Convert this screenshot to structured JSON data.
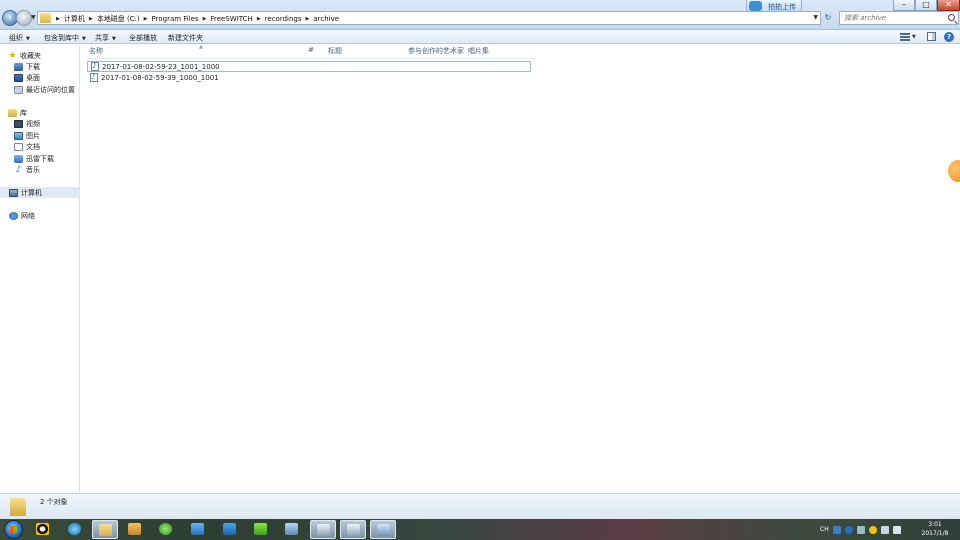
{
  "address": {
    "crumbs": [
      "计算机",
      "本地磁盘 (C:)",
      "Program Files",
      "FreeSWITCH",
      "recordings",
      "archive"
    ],
    "search_placeholder": "搜索 archive"
  },
  "upload_label": "拍拍上传",
  "toolbar": {
    "organize": "组织",
    "include_library": "包含到库中",
    "share": "共享",
    "play_all": "全部播放",
    "new_folder": "新建文件夹"
  },
  "nav": {
    "favorites": "收藏夹",
    "downloads": "下载",
    "desktop": "桌面",
    "recent": "最近访问的位置",
    "libraries": "库",
    "videos": "视频",
    "pictures": "图片",
    "documents": "文档",
    "thunder": "迅雷下载",
    "music": "音乐",
    "computer": "计算机",
    "network": "网络"
  },
  "columns": {
    "name": "名称",
    "number": "#",
    "title": "标题",
    "artist": "参与创作的艺术家",
    "album": "唱片集"
  },
  "files": [
    {
      "name": "2017-01-08-02-59-23_1001_1000"
    },
    {
      "name": "2017-01-08-02-59-39_1000_1001"
    }
  ],
  "status": {
    "count": "2 个对象"
  },
  "tray": {
    "lang": "CH",
    "time": "3:01",
    "date": "2017/1/8"
  },
  "colors": {
    "accent": "#3b78c4",
    "selection": "#dfe8f3"
  }
}
